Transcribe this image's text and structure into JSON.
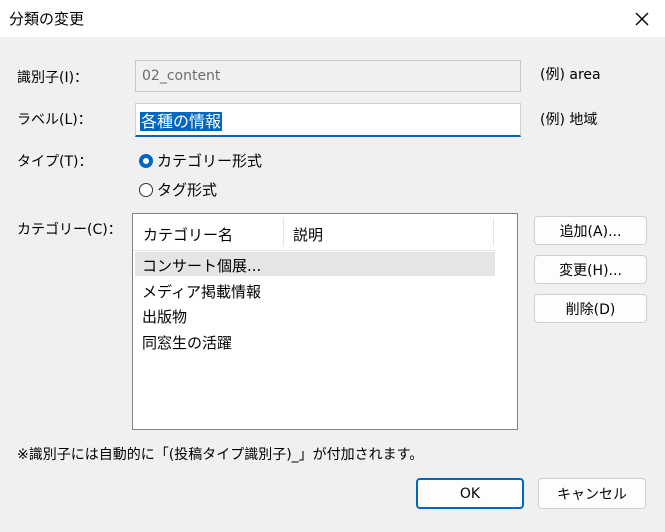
{
  "window": {
    "title": "分類の変更"
  },
  "identifier": {
    "label": "識別子(I)：",
    "value": "02_content",
    "example": "(例) area"
  },
  "label_field": {
    "label": "ラベル(L)：",
    "value": "各種の情報",
    "example": "(例) 地域"
  },
  "type": {
    "label": "タイプ(T)：",
    "options": [
      "カテゴリー形式",
      "タグ形式"
    ],
    "selected": "カテゴリー形式"
  },
  "category": {
    "label": "カテゴリー(C)：",
    "columns": [
      "カテゴリー名",
      "説明"
    ],
    "rows": [
      "コンサート個展...",
      "メディア掲載情報",
      "出版物",
      "同窓生の活躍"
    ]
  },
  "buttons": {
    "add": "追加(A)...",
    "edit": "変更(H)...",
    "delete": "削除(D)",
    "ok": "OK",
    "cancel": "キャンセル"
  },
  "note": "※識別子には自動的に「(投稿タイプ識別子)_」が付加されます。"
}
